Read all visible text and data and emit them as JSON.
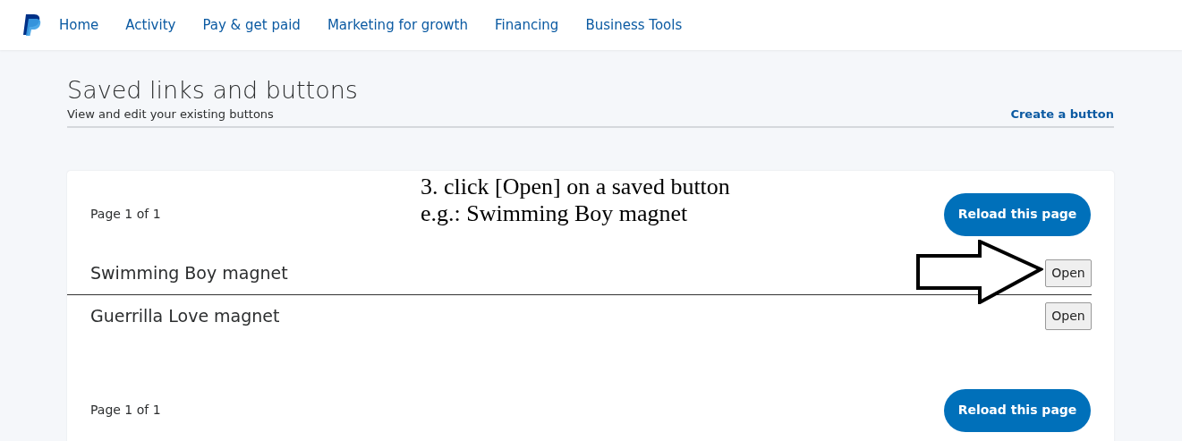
{
  "nav": {
    "items": [
      {
        "label": "Home"
      },
      {
        "label": "Activity"
      },
      {
        "label": "Pay & get paid"
      },
      {
        "label": "Marketing for growth"
      },
      {
        "label": "Financing"
      },
      {
        "label": "Business Tools"
      }
    ]
  },
  "header": {
    "title": "Saved links and buttons",
    "subtitle": "View and edit your existing buttons",
    "action": "Create a button"
  },
  "annotation": {
    "lines": [
      "3. click [Open] on a saved button",
      "e.g.: Swimming Boy magnet"
    ]
  },
  "top_pager": {
    "text": "Page 1 of 1",
    "button": "Reload this page"
  },
  "rows": [
    {
      "name": "Swimming Boy magnet",
      "button": "Open"
    },
    {
      "name": "Guerrilla Love magnet",
      "button": "Open"
    }
  ],
  "bottom_pager": {
    "text": "Page 1 of 1",
    "button": "Reload this page"
  }
}
